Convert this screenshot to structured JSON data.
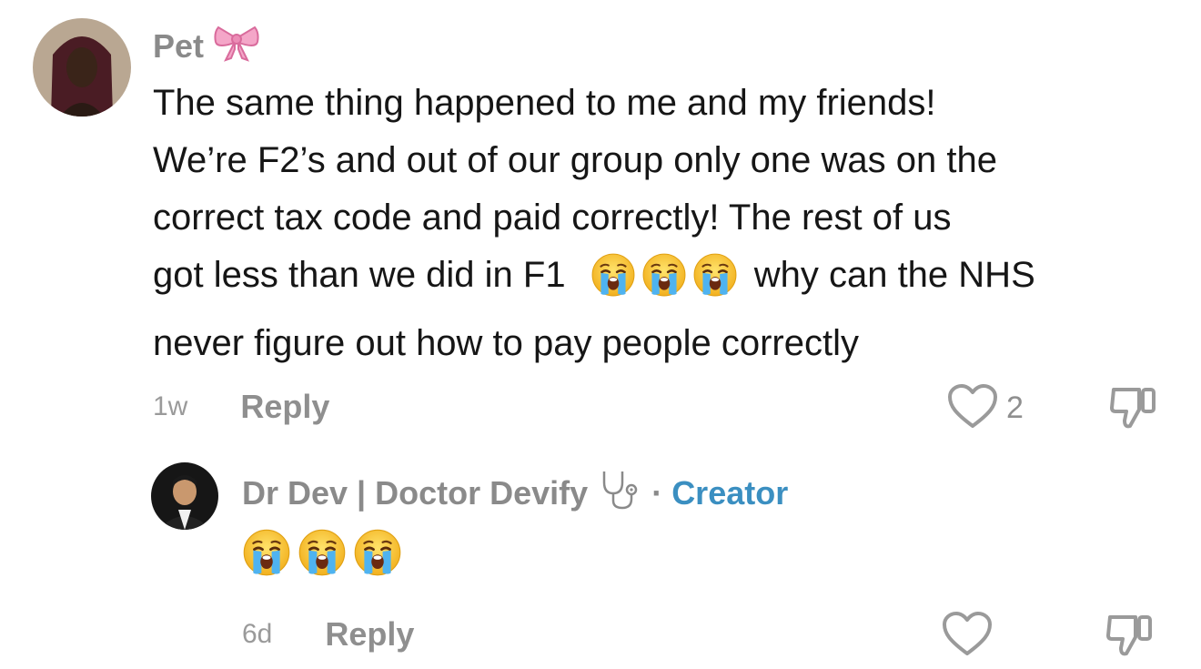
{
  "comment": {
    "username": "Pet",
    "username_icon": "pink-bow-icon",
    "text_lines": [
      "The same thing happened to me and my friends!",
      "We’re F2’s and out of our group only one was on the",
      "correct tax code and paid correctly! The rest of us",
      "got less than we did in F1",
      "why can the NHS",
      "never figure out how to pay people correctly"
    ],
    "emoji": "crying-face-icon",
    "time": "1w",
    "reply_label": "Reply",
    "like_count": "2"
  },
  "reply": {
    "username": "Dr Dev | Doctor Devify",
    "username_icon": "stethoscope-icon",
    "separator": "·",
    "badge": "Creator",
    "emoji": "crying-face-icon",
    "time": "6d",
    "reply_label": "Reply"
  },
  "colors": {
    "creator_badge": "#3b8fc1",
    "muted_text": "#8f8f8f",
    "body_text": "#161616"
  }
}
